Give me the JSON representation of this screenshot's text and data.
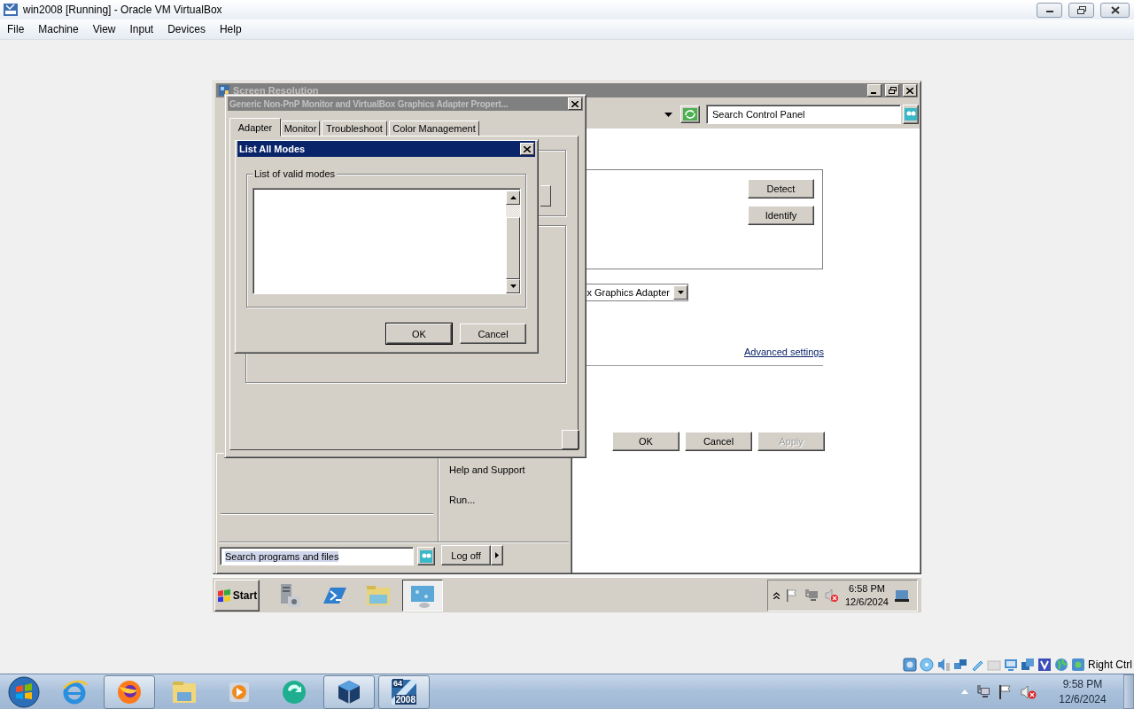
{
  "host_window": {
    "title": "win2008 [Running] - Oracle VM VirtualBox",
    "menu": [
      {
        "label": "File"
      },
      {
        "label": "Machine"
      },
      {
        "label": "View"
      },
      {
        "label": "Input"
      },
      {
        "label": "Devices"
      },
      {
        "label": "Help"
      }
    ]
  },
  "guest": {
    "screen_resolution": {
      "title": "Screen Resolution",
      "active": false,
      "search": {
        "placeholder": "Search Control Panel"
      },
      "monitor_buttons": [
        {
          "label": "Detect",
          "disabled": false
        },
        {
          "label": "Identify",
          "disabled": false
        }
      ],
      "display_dropdown": {
        "value": "x Graphics Adapter"
      },
      "advanced_link": "Advanced settings",
      "buttons": [
        {
          "label": "OK",
          "disabled": false
        },
        {
          "label": "Cancel",
          "disabled": false
        },
        {
          "label": "Apply",
          "disabled": true
        }
      ]
    },
    "start_menu": {
      "items": [
        {
          "label": "Help and Support"
        },
        {
          "label": "Run..."
        }
      ],
      "search": {
        "value": "Search programs and files",
        "text_selected": true
      },
      "log_off": "Log off"
    },
    "properties_dialog": {
      "title": "Generic Non-PnP Monitor and VirtualBox Graphics Adapter Propert...",
      "active": false,
      "tabs": [
        {
          "label": "Adapter",
          "selected": true
        },
        {
          "label": "Monitor",
          "selected": false
        },
        {
          "label": "Troubleshoot",
          "selected": false
        },
        {
          "label": "Color Management",
          "selected": false
        }
      ]
    },
    "list_modes_dialog": {
      "title": "List All Modes",
      "active": true,
      "group_label": "List of valid modes",
      "buttons": [
        {
          "label": "OK"
        },
        {
          "label": "Cancel"
        }
      ]
    },
    "taskbar": {
      "start": "Start",
      "quick_launch": [
        {
          "kind": "server-manager",
          "selected": false
        },
        {
          "kind": "powershell",
          "selected": false
        },
        {
          "kind": "explorer",
          "selected": false
        },
        {
          "kind": "display",
          "selected": true
        }
      ],
      "tray": {
        "time": "6:58 PM",
        "date": "12/6/2024"
      }
    }
  },
  "status_bar": {
    "host_key": "Right Ctrl"
  },
  "taskbar": {
    "apps": [
      {
        "kind": "ie",
        "open": false
      },
      {
        "kind": "firefox",
        "open": true
      },
      {
        "kind": "explorer",
        "open": false
      },
      {
        "kind": "media",
        "open": false
      },
      {
        "kind": "green",
        "open": false
      },
      {
        "kind": "virtualbox",
        "open": true
      },
      {
        "kind": "vm",
        "open": true,
        "badge": "64",
        "caption": "2008"
      }
    ],
    "tray": {
      "time": "9:58 PM",
      "date": "12/6/2024"
    }
  }
}
